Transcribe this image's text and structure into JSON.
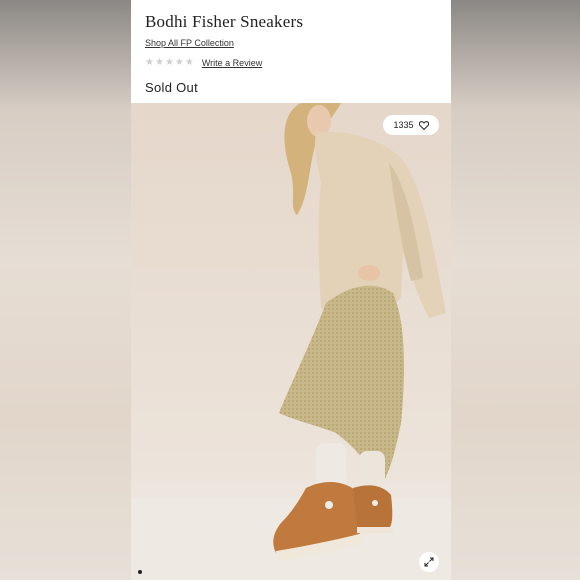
{
  "product": {
    "title": "Bodhi Fisher Sneakers",
    "collection_link": "Shop All FP Collection",
    "rating_stars": 0,
    "review_link": "Write a Review",
    "stock_status": "Sold Out"
  },
  "gallery": {
    "like_count": "1335",
    "image_description_icon": "product-photo"
  },
  "colors": {
    "page_bg": "#ffffff",
    "text": "#222222",
    "star_empty": "#cfcfcf"
  }
}
